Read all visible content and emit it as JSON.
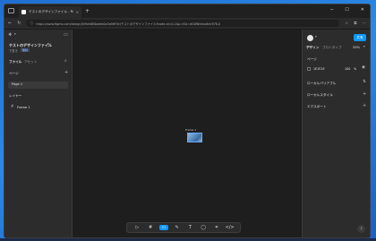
{
  "browser": {
    "tab_title": "テストのデザインファイル - Figma",
    "tab_close": "×",
    "new_tab": "+",
    "url": "https://www.figma.com/design/IV9xh6E6aeeb0a3a9HFXr/テストのデザインファイル?node-id=0-1&p=f&t=dGWNfxtsc6eV97K-0",
    "window_controls": [
      "─",
      "☐",
      "✕"
    ]
  },
  "file": {
    "name": "テストのデザインファイル",
    "team": "下書き",
    "plan_badge": "無料"
  },
  "left_panel": {
    "tabs": [
      "ファイル",
      "アセット"
    ],
    "pages_title": "ページ",
    "pages": [
      "Page 1"
    ],
    "layers_title": "レイヤー",
    "layers": [
      "Frame 1"
    ]
  },
  "right_panel": {
    "share_label": "共有",
    "tabs": [
      "デザイン",
      "プロトタイプ"
    ],
    "zoom": "33%",
    "page_section": "ページ",
    "page_color": "1E1E1E",
    "page_opacity": "100",
    "page_opacity_unit": "%",
    "local_variables": "ローカルバリアブル",
    "local_styles": "ローカルスタイル",
    "export": "エクスポート"
  },
  "canvas": {
    "frame_label": "Frame 1"
  },
  "toolbar": {
    "tools": [
      "▷",
      "#",
      "▭",
      "✎",
      "T",
      "◯",
      "⌗",
      "</>"
    ],
    "help": "?"
  },
  "colors": {
    "accent": "#0d99ff",
    "canvas_bg": "#1e1e1e",
    "panel_bg": "#2c2c2c"
  }
}
